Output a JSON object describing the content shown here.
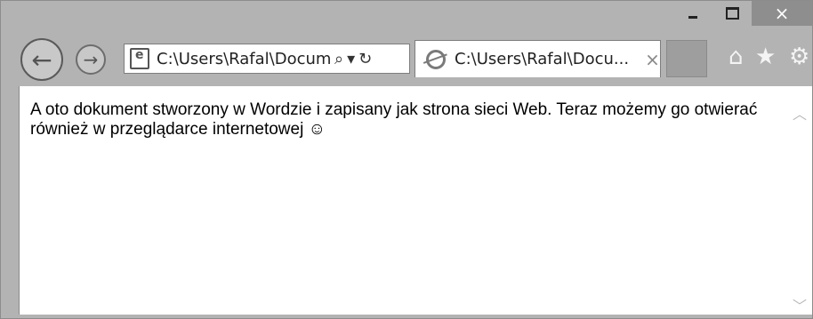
{
  "window": {
    "controls": {
      "minimize": "–",
      "maximize": "□",
      "close": "×"
    }
  },
  "address_bar": {
    "value": "C:\\Users\\Rafal\\Docum",
    "icons": [
      "search-icon",
      "dropdown-icon",
      "refresh-icon"
    ],
    "search_glyph": "⌕",
    "dropdown_glyph": "▾",
    "refresh_glyph": "↻"
  },
  "tab": {
    "title": "C:\\Users\\Rafal\\Docu...",
    "close_glyph": "×"
  },
  "toolbar": {
    "home_glyph": "⌂",
    "favorites_glyph": "★",
    "tools_glyph": "⚙"
  },
  "document": {
    "text": "A oto dokument stworzony w Wordzie i zapisany jak strona sieci Web. Teraz możemy go otwierać również w przeglądarce internetowej ☺"
  },
  "scrollbar": {
    "up_glyph": "︿",
    "down_glyph": "﹀"
  }
}
